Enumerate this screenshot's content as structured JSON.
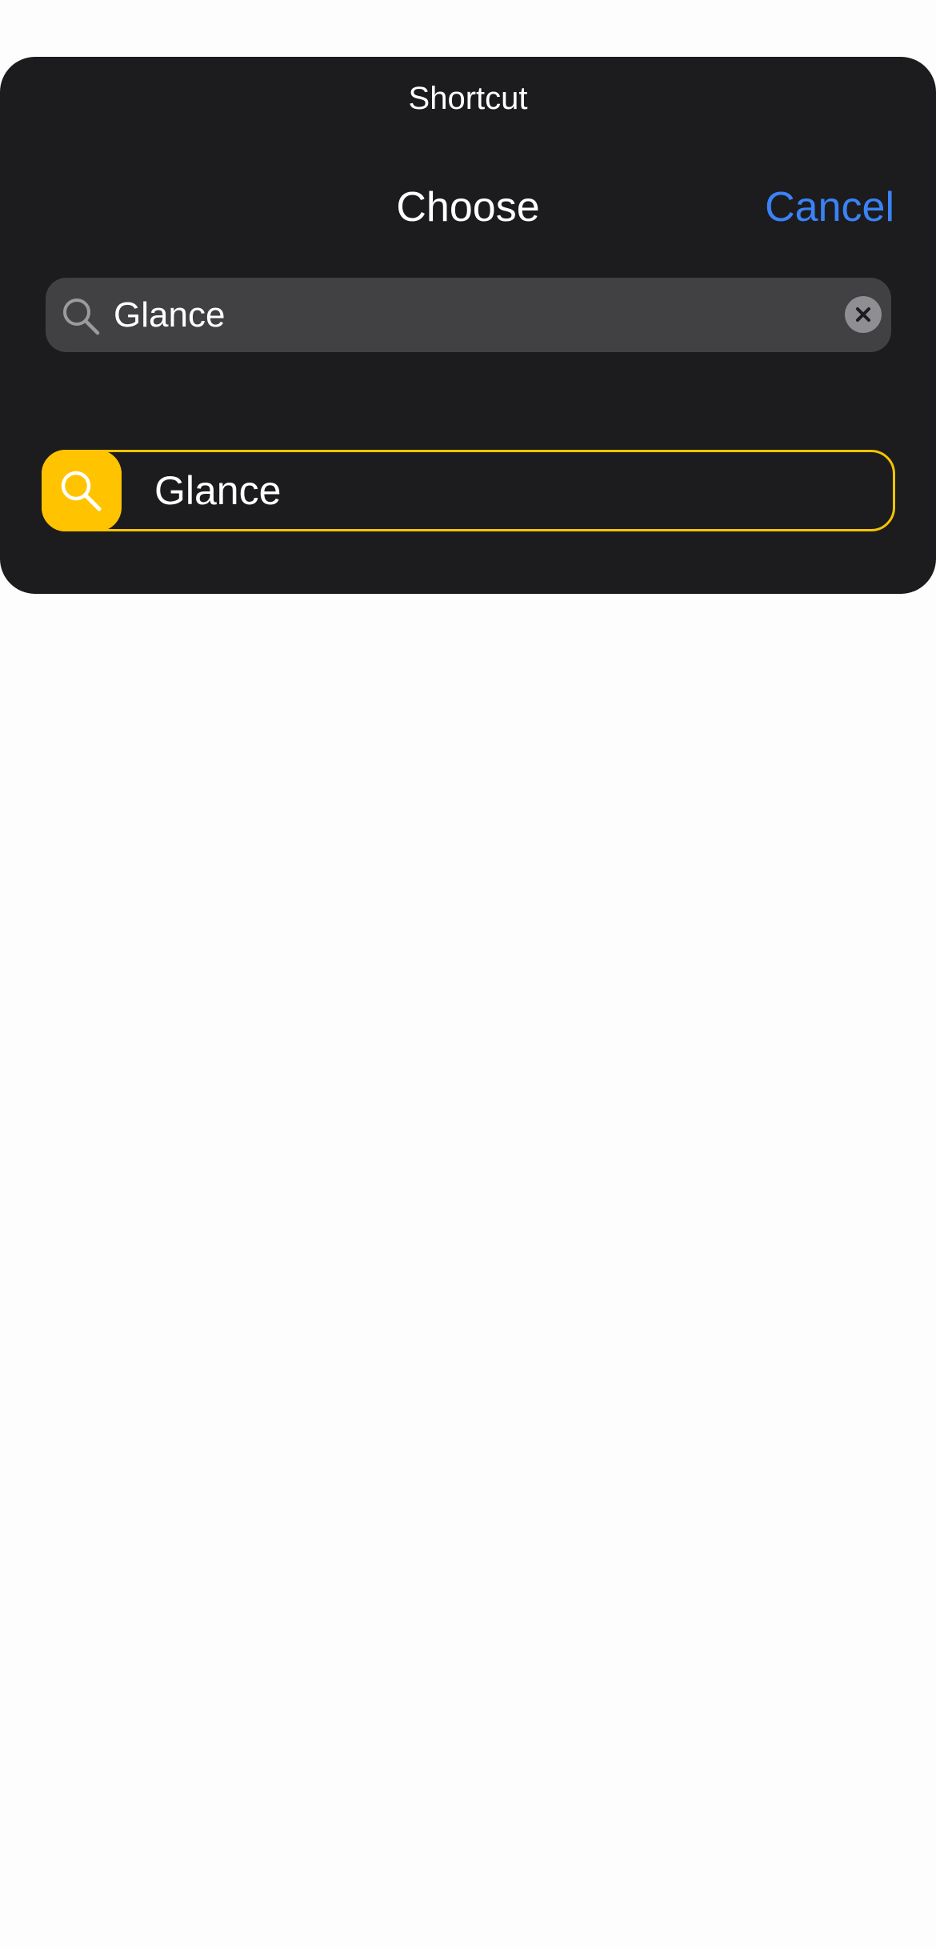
{
  "header": {
    "app_label": "Shortcut",
    "title": "Choose",
    "cancel_label": "Cancel"
  },
  "search": {
    "value": "Glance",
    "icon": "search-icon",
    "clear_icon": "clear-icon"
  },
  "results": [
    {
      "label": "Glance",
      "icon": "search-icon"
    }
  ],
  "colors": {
    "sheet_background": "#1c1c1e",
    "search_field_background": "#414143",
    "accent_blue": "#3b82f6",
    "result_highlight": "#f5c400",
    "result_icon_tile": "#ffc300",
    "page_background": "#fdfdfd"
  }
}
